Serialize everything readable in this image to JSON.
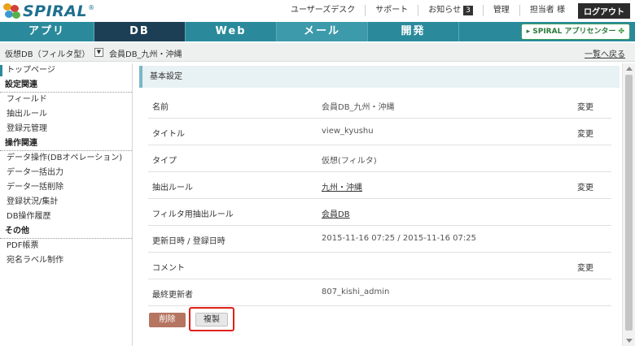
{
  "header": {
    "logo_text": "SPIRAL",
    "logo_reg": "®",
    "links": {
      "user_desk": "ユーザーズデスク",
      "support": "サポート",
      "notice": "お知らせ",
      "notice_count": "3",
      "admin": "管理",
      "person": "担当者 様",
      "logout": "ログアウト"
    }
  },
  "nav": {
    "tabs": [
      "アプリ",
      "DB",
      "Web",
      "メール",
      "開発"
    ],
    "active_tab": "DB",
    "partner": "SPIRAL アプリセンター"
  },
  "breadcrumb": {
    "db_type": "仮想DB（フィルタ型）",
    "db_name": "会員DB_九州・沖縄",
    "back_link": "一覧へ戻る"
  },
  "sidebar": {
    "top": "トップページ",
    "sections": [
      {
        "title": "設定関連",
        "items": [
          "フィールド",
          "抽出ルール",
          "登録元管理"
        ]
      },
      {
        "title": "操作関連",
        "items": [
          "データ操作(DBオペレーション)",
          "データ一括出力",
          "データ一括削除",
          "登録状況/集計",
          "DB操作履歴"
        ]
      },
      {
        "title": "その他",
        "items": [
          "PDF帳票",
          "宛名ラベル制作"
        ]
      }
    ]
  },
  "main": {
    "panel_title": "基本設定",
    "change_label": "変更",
    "rows": [
      {
        "label": "名前",
        "value": "会員DB_九州・沖縄",
        "link": false,
        "changeable": true
      },
      {
        "label": "タイトル",
        "value": "view_kyushu",
        "link": false,
        "changeable": true
      },
      {
        "label": "タイプ",
        "value": "仮想(フィルタ)",
        "link": false,
        "changeable": false
      },
      {
        "label": "抽出ルール",
        "value": "九州・沖縄",
        "link": true,
        "changeable": true
      },
      {
        "label": "フィルタ用抽出ルール",
        "value": "会員DB",
        "link": true,
        "changeable": false
      },
      {
        "label": "更新日時 / 登録日時",
        "value": "2015-11-16 07:25 / 2015-11-16 07:25",
        "link": false,
        "changeable": false
      },
      {
        "label": "コメント",
        "value": "",
        "link": false,
        "changeable": true
      },
      {
        "label": "最終更新者",
        "value": "807_kishi_admin",
        "link": false,
        "changeable": false
      }
    ],
    "delete_label": "削除",
    "copy_label": "複製"
  },
  "colors": {
    "nav_bg": "#2a8a9c",
    "nav_active": "#1d3f55",
    "delete_btn": "#b57561",
    "highlight": "#e0201a"
  }
}
